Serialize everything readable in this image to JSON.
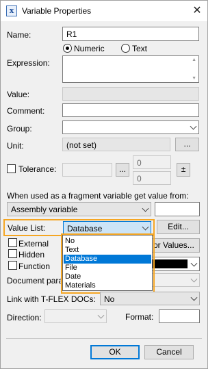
{
  "window": {
    "title": "Variable Properties",
    "close_glyph": "✕",
    "icon_glyph": "x"
  },
  "name": {
    "label": "Name:",
    "value": "R1"
  },
  "type_radio": {
    "numeric": "Numeric",
    "text": "Text",
    "selected": "Numeric"
  },
  "expression": {
    "label": "Expression:",
    "value": ""
  },
  "value": {
    "label": "Value:",
    "value": ""
  },
  "comment": {
    "label": "Comment:",
    "value": ""
  },
  "group": {
    "label": "Group:",
    "value": ""
  },
  "unit": {
    "label": "Unit:",
    "value": "(not set)",
    "button": "..."
  },
  "tolerance": {
    "label": "Tolerance:",
    "button": "...",
    "upper": "0",
    "lower": "0",
    "pm_button": "±",
    "checked": false
  },
  "fragment": {
    "label": "When used as a fragment variable get value from:",
    "selected": "Assembly variable",
    "value": ""
  },
  "value_list": {
    "label": "Value List:",
    "selected": "Database",
    "edit_button": "Edit...",
    "options": [
      "No",
      "Text",
      "Database",
      "File",
      "Date",
      "Materials"
    ]
  },
  "values_button": "or Values...",
  "checkboxes": {
    "external": "External",
    "hidden": "Hidden",
    "function": "Function"
  },
  "color_swatch": "#000000",
  "document_param": {
    "label": "Document param"
  },
  "tflex": {
    "label": "Link with T-FLEX DOCs:",
    "selected": "No"
  },
  "direction": {
    "label": "Direction:",
    "selected": ""
  },
  "format": {
    "label": "Format:",
    "value": ""
  },
  "buttons": {
    "ok": "OK",
    "cancel": "Cancel"
  },
  "colors": {
    "highlight": "#f5a623",
    "accent": "#0078d7"
  }
}
